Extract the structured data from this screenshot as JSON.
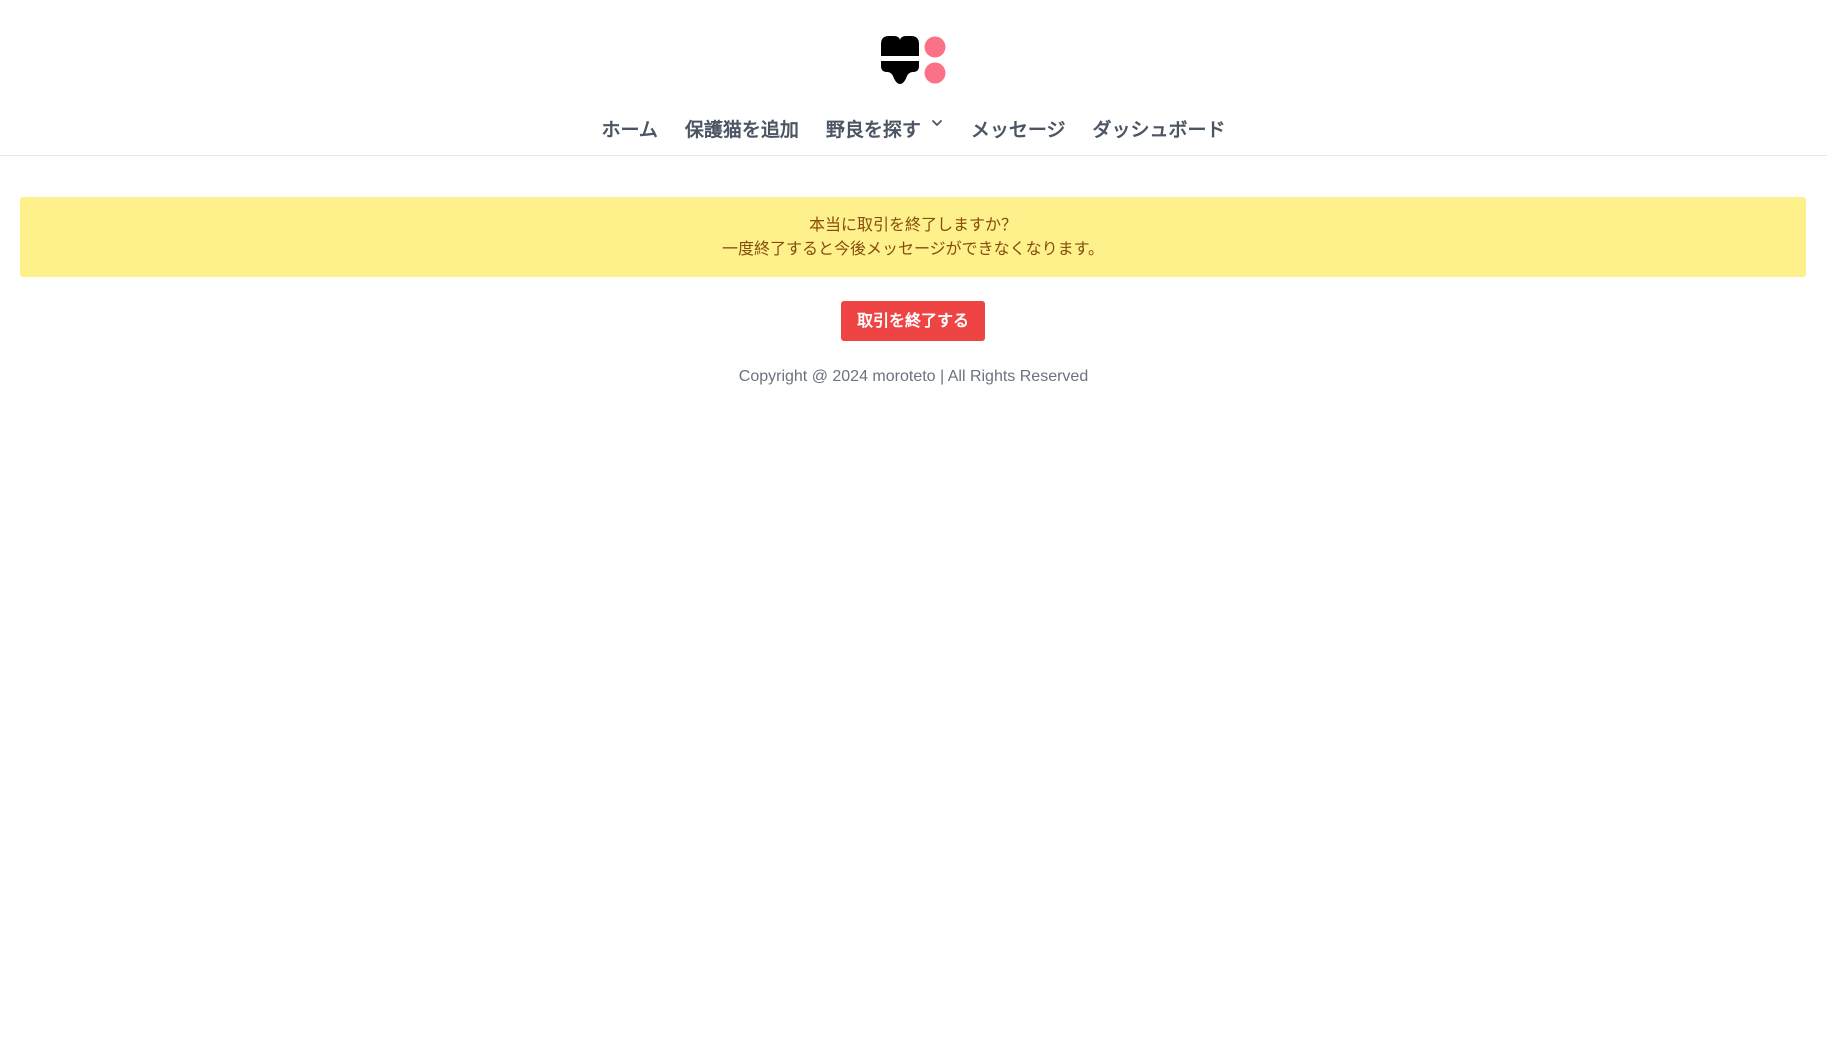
{
  "header": {
    "logo_icon": "cat-paw-logo-icon",
    "logo_colors": {
      "dark": "#000000",
      "accent": "#fb7185"
    },
    "nav": [
      {
        "label": "ホーム"
      },
      {
        "label": "保護猫を追加"
      },
      {
        "label": "野良を探す",
        "dropdown_icon": "chevron-down-icon"
      },
      {
        "label": "メッセージ"
      },
      {
        "label": "ダッシュボード"
      }
    ]
  },
  "alert": {
    "line1": "本当に取引を終了しますか？",
    "line2": "一度終了すると今後メッセージができなくなります。",
    "background": "#fef08a",
    "text_color": "#854d0e"
  },
  "action": {
    "end_label": "取引を終了する",
    "color": "#ef4444"
  },
  "footer": {
    "copyright": "Copyright @ 2024 moroteto | All Rights Reserved"
  }
}
